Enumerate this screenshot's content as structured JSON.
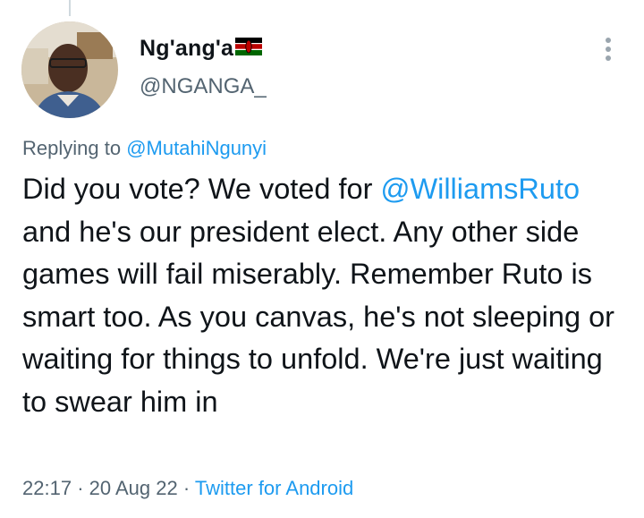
{
  "author": {
    "display_name": "Ng'ang'a",
    "handle": "@NGANGA_",
    "flag_icon": "kenya-flag-icon"
  },
  "tweet": {
    "replying_prefix": "Replying to",
    "replying_to": "@MutahiNgunyi",
    "text_before_mention": "Did you vote? We voted for ",
    "mention": "@WilliamsRuto",
    "text_after_mention": " and he's our president elect. Any other side games will fail miserably. Remember Ruto is smart too. As you canvas, he's not sleeping or waiting for things to unfold. We're just waiting to swear him in",
    "time": "22:17",
    "date": "20 Aug 22",
    "separator": "·",
    "source": "Twitter for Android"
  },
  "icons": {
    "more": "more-vertical-icon",
    "avatar": "avatar"
  },
  "colors": {
    "text": "#0f1419",
    "secondary": "#536471",
    "link": "#1d9bf0"
  }
}
